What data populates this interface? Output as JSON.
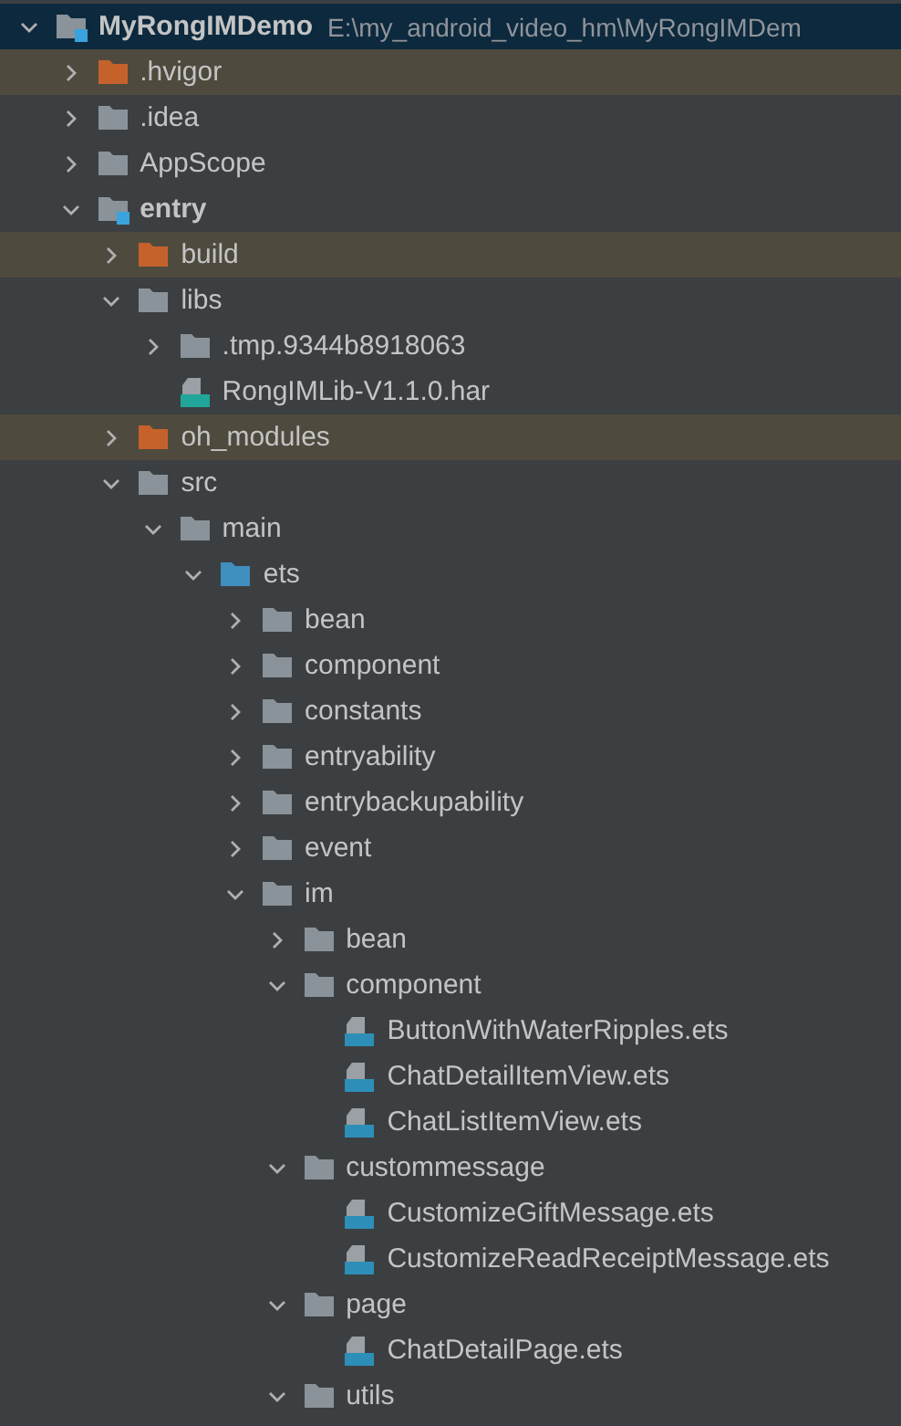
{
  "project_tree": [
    {
      "label": "MyRongIMDemo",
      "path": "E:\\my_android_video_hm\\MyRongIMDem",
      "kind": "module",
      "selected": true,
      "expanded": true,
      "children": [
        {
          "label": ".hvigor",
          "kind": "excluded",
          "selected": false,
          "expanded": false
        },
        {
          "label": ".idea",
          "kind": "folder",
          "selected": false,
          "expanded": false
        },
        {
          "label": "AppScope",
          "kind": "folder",
          "selected": false,
          "expanded": false
        },
        {
          "label": "entry",
          "kind": "module",
          "selected": false,
          "expanded": true,
          "children": [
            {
              "label": "build",
              "kind": "excluded",
              "selected": false,
              "expanded": false
            },
            {
              "label": "libs",
              "kind": "folder",
              "selected": false,
              "expanded": true,
              "children": [
                {
                  "label": ".tmp.9344b8918063",
                  "kind": "folder",
                  "selected": false,
                  "expanded": false
                },
                {
                  "label": "RongIMLib-V1.1.0.har",
                  "kind": "har",
                  "selected": false
                }
              ]
            },
            {
              "label": "oh_modules",
              "kind": "excluded",
              "selected": false,
              "expanded": false
            },
            {
              "label": "src",
              "kind": "folder",
              "selected": false,
              "expanded": true,
              "children": [
                {
                  "label": "main",
                  "kind": "folder",
                  "selected": false,
                  "expanded": true,
                  "children": [
                    {
                      "label": "ets",
                      "kind": "source",
                      "selected": false,
                      "expanded": true,
                      "children": [
                        {
                          "label": "bean",
                          "kind": "folder",
                          "selected": false,
                          "expanded": false
                        },
                        {
                          "label": "component",
                          "kind": "folder",
                          "selected": false,
                          "expanded": false
                        },
                        {
                          "label": "constants",
                          "kind": "folder",
                          "selected": false,
                          "expanded": false
                        },
                        {
                          "label": "entryability",
                          "kind": "folder",
                          "selected": false,
                          "expanded": false
                        },
                        {
                          "label": "entrybackupability",
                          "kind": "folder",
                          "selected": false,
                          "expanded": false
                        },
                        {
                          "label": "event",
                          "kind": "folder",
                          "selected": false,
                          "expanded": false
                        },
                        {
                          "label": "im",
                          "kind": "folder",
                          "selected": false,
                          "expanded": true,
                          "children": [
                            {
                              "label": "bean",
                              "kind": "folder",
                              "selected": false,
                              "expanded": false
                            },
                            {
                              "label": "component",
                              "kind": "folder",
                              "selected": false,
                              "expanded": true,
                              "children": [
                                {
                                  "label": "ButtonWithWaterRipples.ets",
                                  "kind": "ets",
                                  "selected": false
                                },
                                {
                                  "label": "ChatDetailItemView.ets",
                                  "kind": "ets",
                                  "selected": false
                                },
                                {
                                  "label": "ChatListItemView.ets",
                                  "kind": "ets",
                                  "selected": false
                                }
                              ]
                            },
                            {
                              "label": "custommessage",
                              "kind": "folder",
                              "selected": false,
                              "expanded": true,
                              "children": [
                                {
                                  "label": "CustomizeGiftMessage.ets",
                                  "kind": "ets",
                                  "selected": false
                                },
                                {
                                  "label": "CustomizeReadReceiptMessage.ets",
                                  "kind": "ets",
                                  "selected": false
                                }
                              ]
                            },
                            {
                              "label": "page",
                              "kind": "folder",
                              "selected": false,
                              "expanded": true,
                              "children": [
                                {
                                  "label": "ChatDetailPage.ets",
                                  "kind": "ets",
                                  "selected": false
                                }
                              ]
                            },
                            {
                              "label": "utils",
                              "kind": "folder",
                              "selected": false,
                              "expanded": true
                            }
                          ]
                        }
                      ]
                    }
                  ]
                }
              ]
            }
          ]
        }
      ]
    }
  ]
}
